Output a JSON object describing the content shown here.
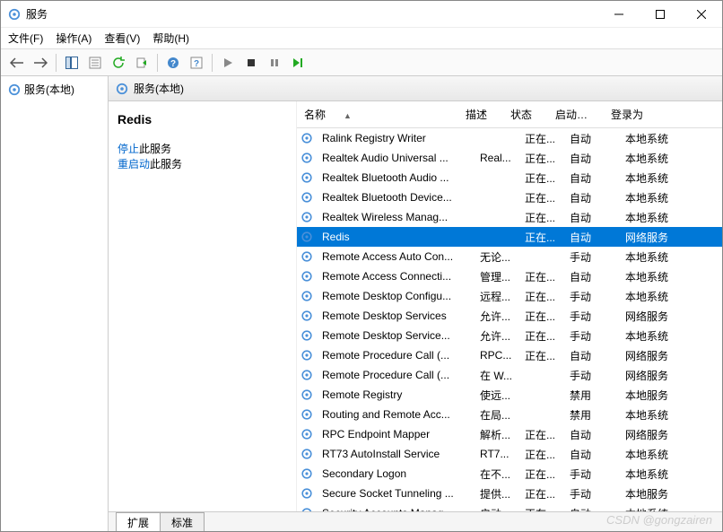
{
  "window": {
    "title": "服务"
  },
  "menu": {
    "file": "文件(F)",
    "action": "操作(A)",
    "view": "查看(V)",
    "help": "帮助(H)"
  },
  "tree": {
    "root": "服务(本地)"
  },
  "content_header": {
    "label": "服务(本地)"
  },
  "desc": {
    "selected": "Redis",
    "stop_link": "停止",
    "stop_suffix": "此服务",
    "restart_link": "重启动",
    "restart_suffix": "此服务"
  },
  "columns": {
    "name": "名称",
    "desc": "描述",
    "status": "状态",
    "startup": "启动类型",
    "login": "登录为"
  },
  "services": [
    {
      "name": "Ralink Registry Writer",
      "desc": "",
      "status": "正在...",
      "startup": "自动",
      "login": "本地系统"
    },
    {
      "name": "Realtek Audio Universal ...",
      "desc": "Real...",
      "status": "正在...",
      "startup": "自动",
      "login": "本地系统"
    },
    {
      "name": "Realtek Bluetooth Audio ...",
      "desc": "",
      "status": "正在...",
      "startup": "自动",
      "login": "本地系统"
    },
    {
      "name": "Realtek Bluetooth Device...",
      "desc": "",
      "status": "正在...",
      "startup": "自动",
      "login": "本地系统"
    },
    {
      "name": "Realtek Wireless Manag...",
      "desc": "",
      "status": "正在...",
      "startup": "自动",
      "login": "本地系统"
    },
    {
      "name": "Redis",
      "desc": "",
      "status": "正在...",
      "startup": "自动",
      "login": "网络服务",
      "selected": true
    },
    {
      "name": "Remote Access Auto Con...",
      "desc": "无论...",
      "status": "",
      "startup": "手动",
      "login": "本地系统"
    },
    {
      "name": "Remote Access Connecti...",
      "desc": "管理...",
      "status": "正在...",
      "startup": "自动",
      "login": "本地系统"
    },
    {
      "name": "Remote Desktop Configu...",
      "desc": "远程...",
      "status": "正在...",
      "startup": "手动",
      "login": "本地系统"
    },
    {
      "name": "Remote Desktop Services",
      "desc": "允许...",
      "status": "正在...",
      "startup": "手动",
      "login": "网络服务"
    },
    {
      "name": "Remote Desktop Service...",
      "desc": "允许...",
      "status": "正在...",
      "startup": "手动",
      "login": "本地系统"
    },
    {
      "name": "Remote Procedure Call (...",
      "desc": "RPC...",
      "status": "正在...",
      "startup": "自动",
      "login": "网络服务"
    },
    {
      "name": "Remote Procedure Call (...",
      "desc": "在 W...",
      "status": "",
      "startup": "手动",
      "login": "网络服务"
    },
    {
      "name": "Remote Registry",
      "desc": "使远...",
      "status": "",
      "startup": "禁用",
      "login": "本地服务"
    },
    {
      "name": "Routing and Remote Acc...",
      "desc": "在局...",
      "status": "",
      "startup": "禁用",
      "login": "本地系统"
    },
    {
      "name": "RPC Endpoint Mapper",
      "desc": "解析...",
      "status": "正在...",
      "startup": "自动",
      "login": "网络服务"
    },
    {
      "name": "RT73 AutoInstall Service",
      "desc": "RT7...",
      "status": "正在...",
      "startup": "自动",
      "login": "本地系统"
    },
    {
      "name": "Secondary Logon",
      "desc": "在不...",
      "status": "正在...",
      "startup": "手动",
      "login": "本地系统"
    },
    {
      "name": "Secure Socket Tunneling ...",
      "desc": "提供...",
      "status": "正在...",
      "startup": "手动",
      "login": "本地服务"
    },
    {
      "name": "Security Accounts Manag...",
      "desc": "启动...",
      "status": "正在...",
      "startup": "自动",
      "login": "本地系统"
    }
  ],
  "tabs": {
    "extended": "扩展",
    "standard": "标准"
  },
  "watermark": "CSDN @gongzairen"
}
